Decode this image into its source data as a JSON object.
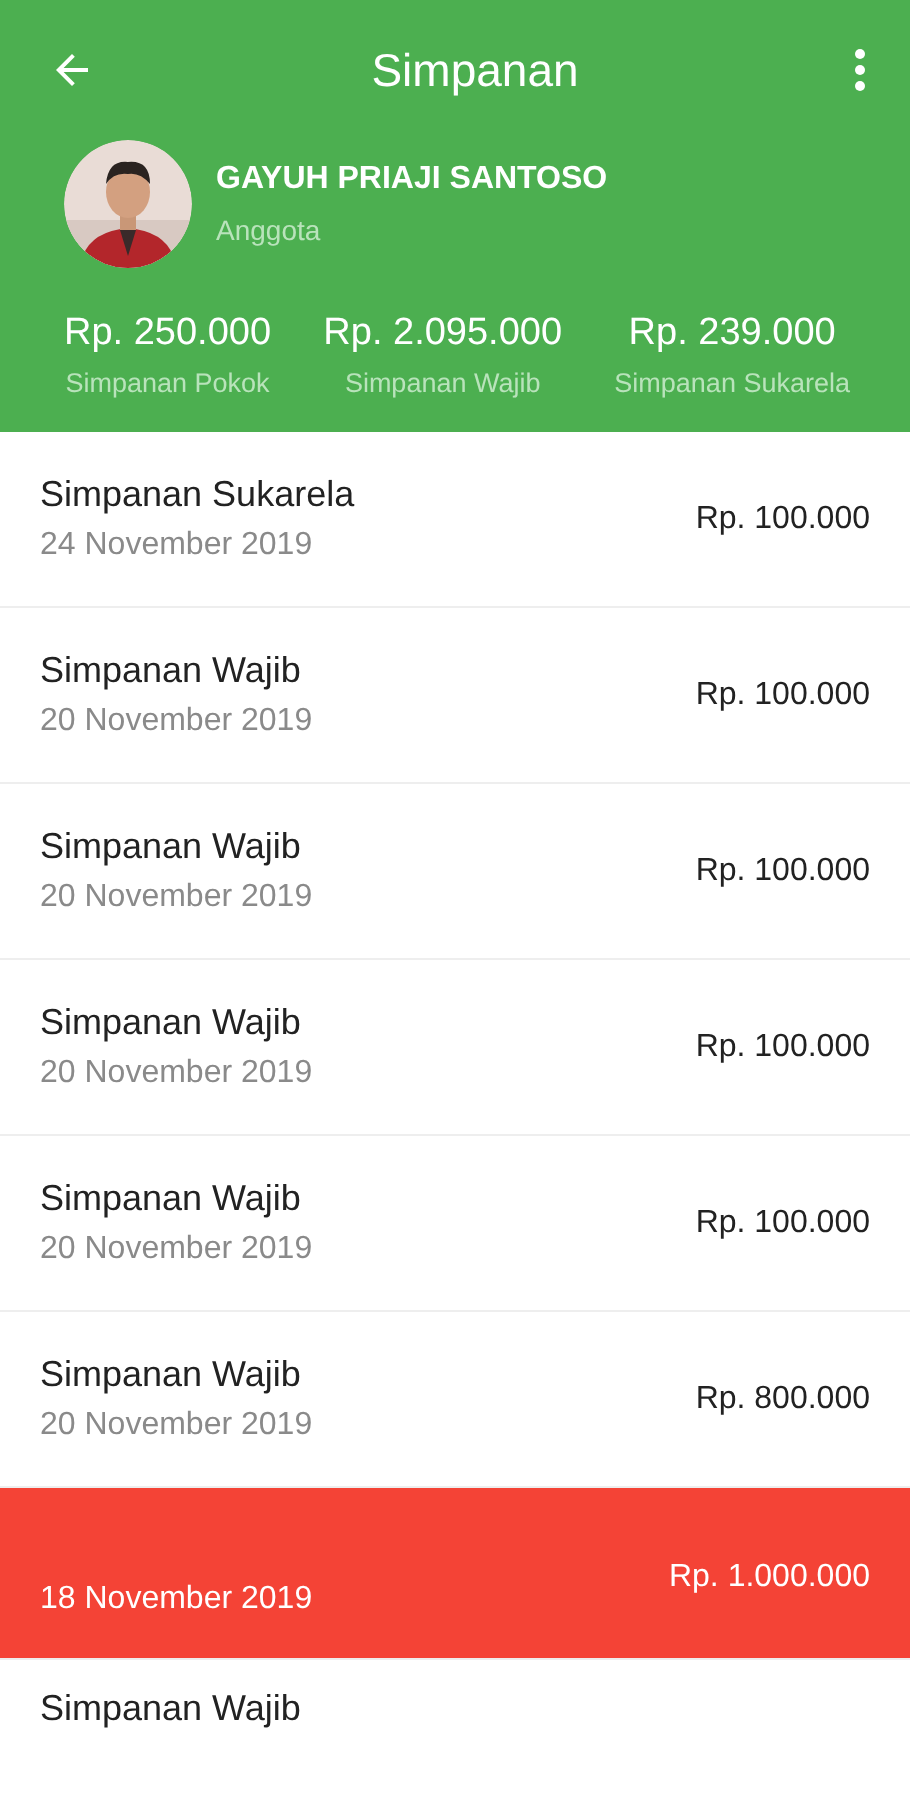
{
  "app_bar": {
    "title": "Simpanan"
  },
  "profile": {
    "name": "GAYUH PRIAJI SANTOSO",
    "role": "Anggota"
  },
  "summary": [
    {
      "amount": "Rp. 250.000",
      "label": "Simpanan Pokok"
    },
    {
      "amount": "Rp. 2.095.000",
      "label": "Simpanan Wajib"
    },
    {
      "amount": "Rp. 239.000",
      "label": "Simpanan Sukarela"
    }
  ],
  "transactions": [
    {
      "kind": "deposit",
      "title": "Simpanan Sukarela",
      "date": "24 November 2019",
      "amount": "Rp. 100.000"
    },
    {
      "kind": "deposit",
      "title": "Simpanan Wajib",
      "date": "20 November 2019",
      "amount": "Rp. 100.000"
    },
    {
      "kind": "deposit",
      "title": "Simpanan Wajib",
      "date": "20 November 2019",
      "amount": "Rp. 100.000"
    },
    {
      "kind": "deposit",
      "title": "Simpanan Wajib",
      "date": "20 November 2019",
      "amount": "Rp. 100.000"
    },
    {
      "kind": "deposit",
      "title": "Simpanan Wajib",
      "date": "20 November 2019",
      "amount": "Rp. 100.000"
    },
    {
      "kind": "deposit",
      "title": "Simpanan Wajib",
      "date": "20 November 2019",
      "amount": "Rp. 800.000"
    },
    {
      "kind": "withdrawal",
      "date": "18 November 2019",
      "amount": "Rp. 1.000.000"
    },
    {
      "kind": "deposit",
      "title": "Simpanan Wajib"
    }
  ]
}
